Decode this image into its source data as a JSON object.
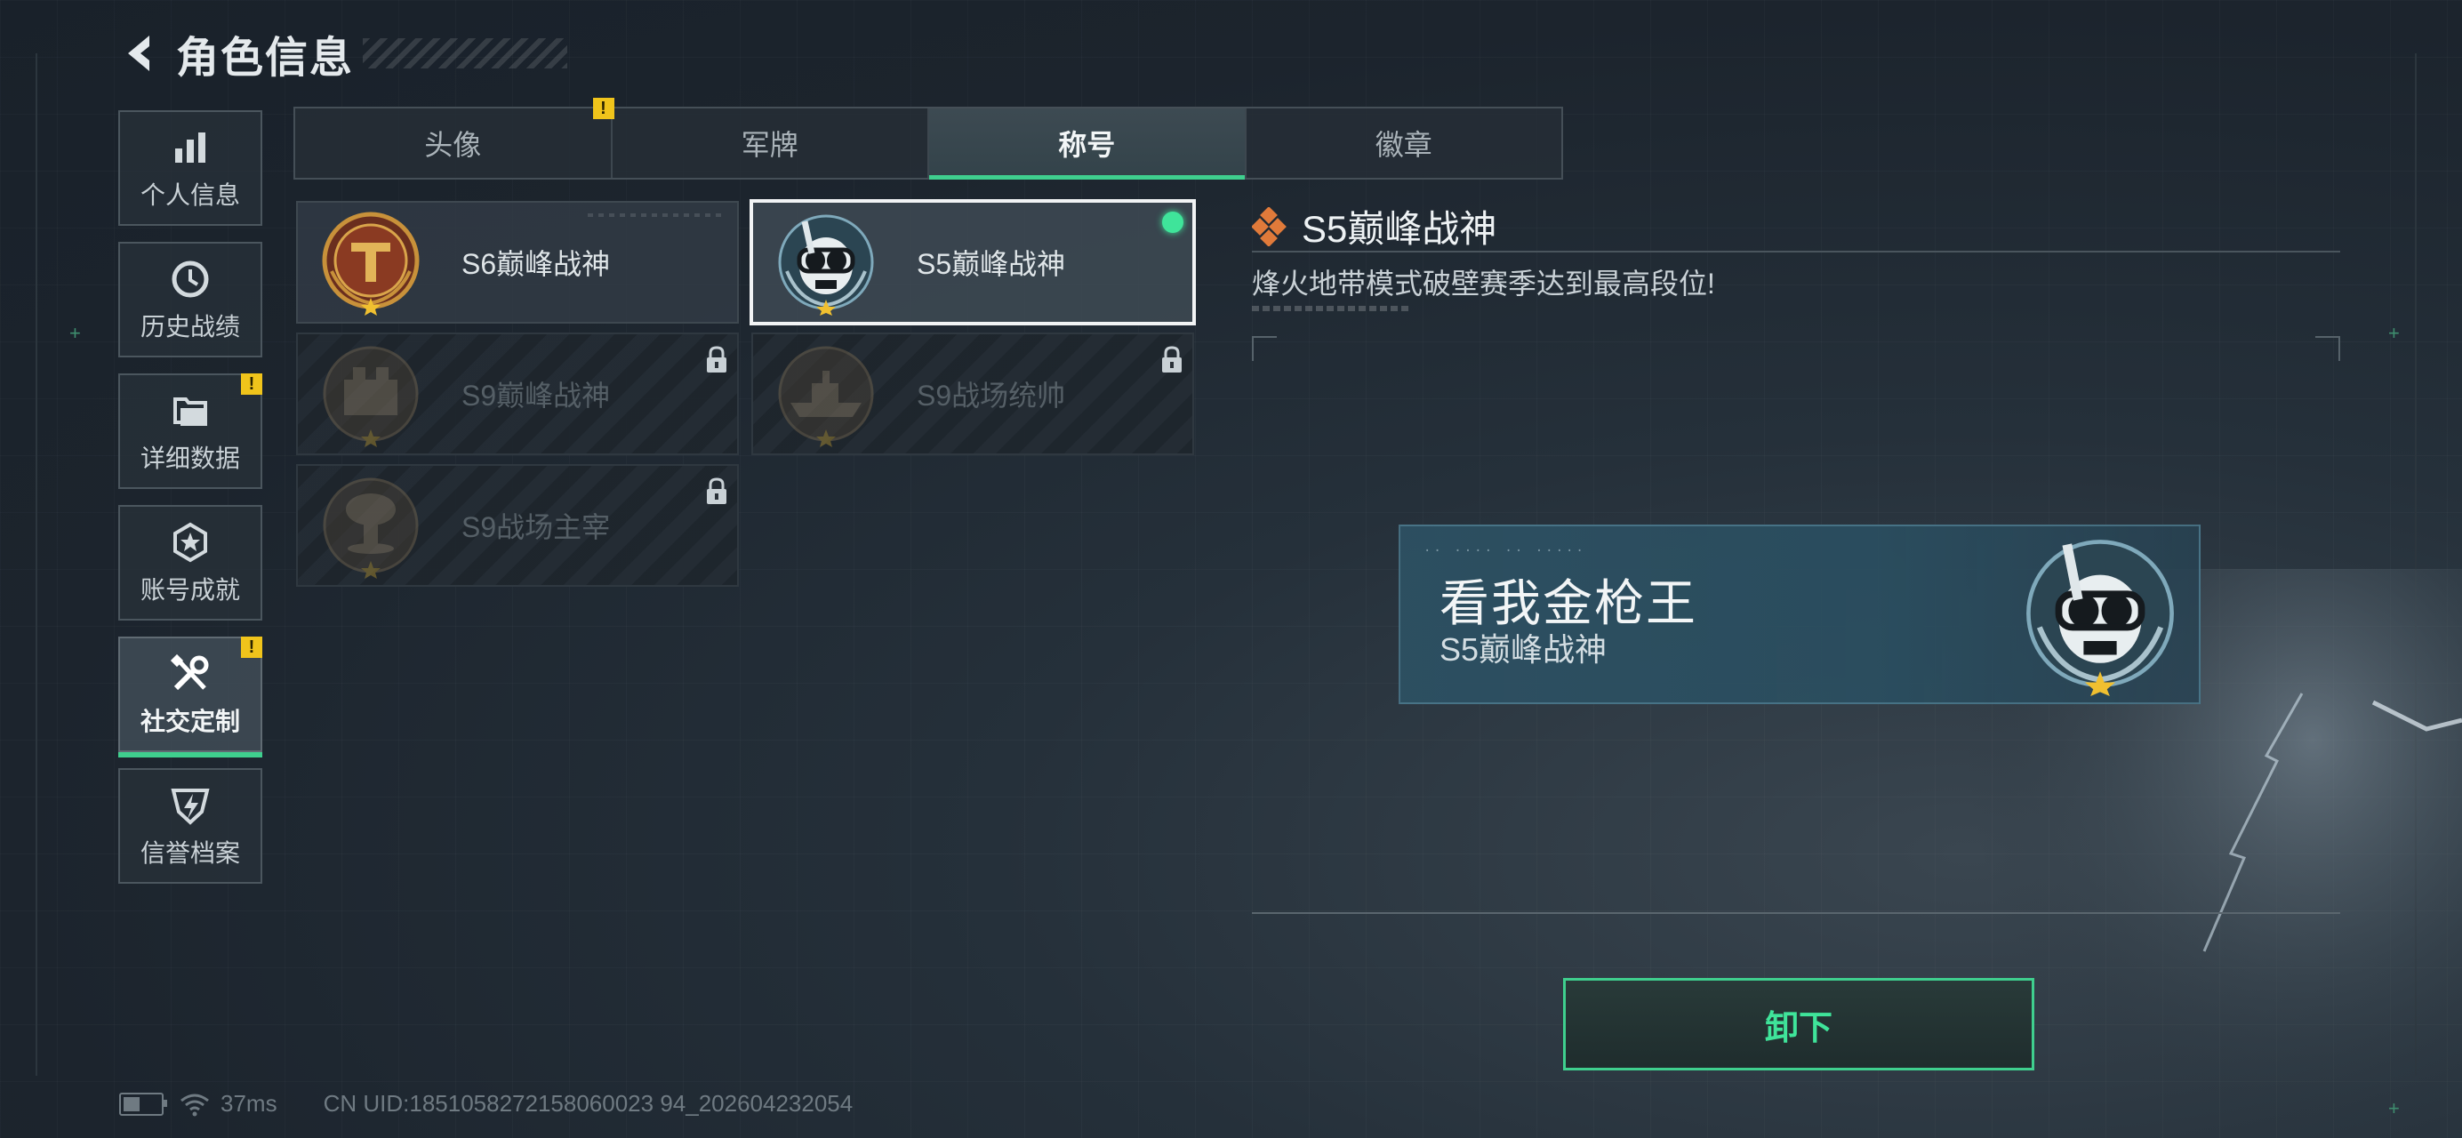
{
  "header": {
    "title": "角色信息"
  },
  "sidebar": {
    "items": [
      {
        "label": "个人信息",
        "icon": "bar-chart-icon",
        "badge": ""
      },
      {
        "label": "历史战绩",
        "icon": "history-icon",
        "badge": ""
      },
      {
        "label": "详细数据",
        "icon": "folder-icon",
        "badge": "!"
      },
      {
        "label": "账号成就",
        "icon": "achievement-icon",
        "badge": ""
      },
      {
        "label": "社交定制",
        "icon": "tools-icon",
        "badge": "!"
      },
      {
        "label": "信誉档案",
        "icon": "credit-icon",
        "badge": ""
      }
    ],
    "active_index": 4
  },
  "tabs": {
    "items": [
      {
        "label": "头像",
        "badge": "!"
      },
      {
        "label": "军牌",
        "badge": ""
      },
      {
        "label": "称号",
        "badge": ""
      },
      {
        "label": "徽章",
        "badge": ""
      }
    ],
    "active_index": 2
  },
  "titles": [
    {
      "label": "S6巅峰战神",
      "state": "unlocked",
      "emblem": "s6-emblem-icon"
    },
    {
      "label": "S5巅峰战神",
      "state": "selected-equipped",
      "emblem": "diver-skull-emblem-icon"
    },
    {
      "label": "S9巅峰战神",
      "state": "locked",
      "emblem": "fortress-emblem-icon"
    },
    {
      "label": "S9战场统帅",
      "state": "locked",
      "emblem": "warship-emblem-icon"
    },
    {
      "label": "S9战场主宰",
      "state": "locked",
      "emblem": "mushroom-cloud-emblem-icon"
    }
  ],
  "detail": {
    "title": "S5巅峰战神",
    "description": "烽火地带模式破壁赛季达到最高段位!"
  },
  "preview": {
    "player_name": "看我金枪王",
    "title": "S5巅峰战神"
  },
  "actions": {
    "unequip_label": "卸下"
  },
  "status": {
    "ping": "37ms",
    "uid": "CN UID:1851058272158060023 94_202604232054"
  },
  "colors": {
    "accent": "#3fcf8e",
    "alert": "#f0c41b",
    "equipped": "#3fe49a"
  }
}
